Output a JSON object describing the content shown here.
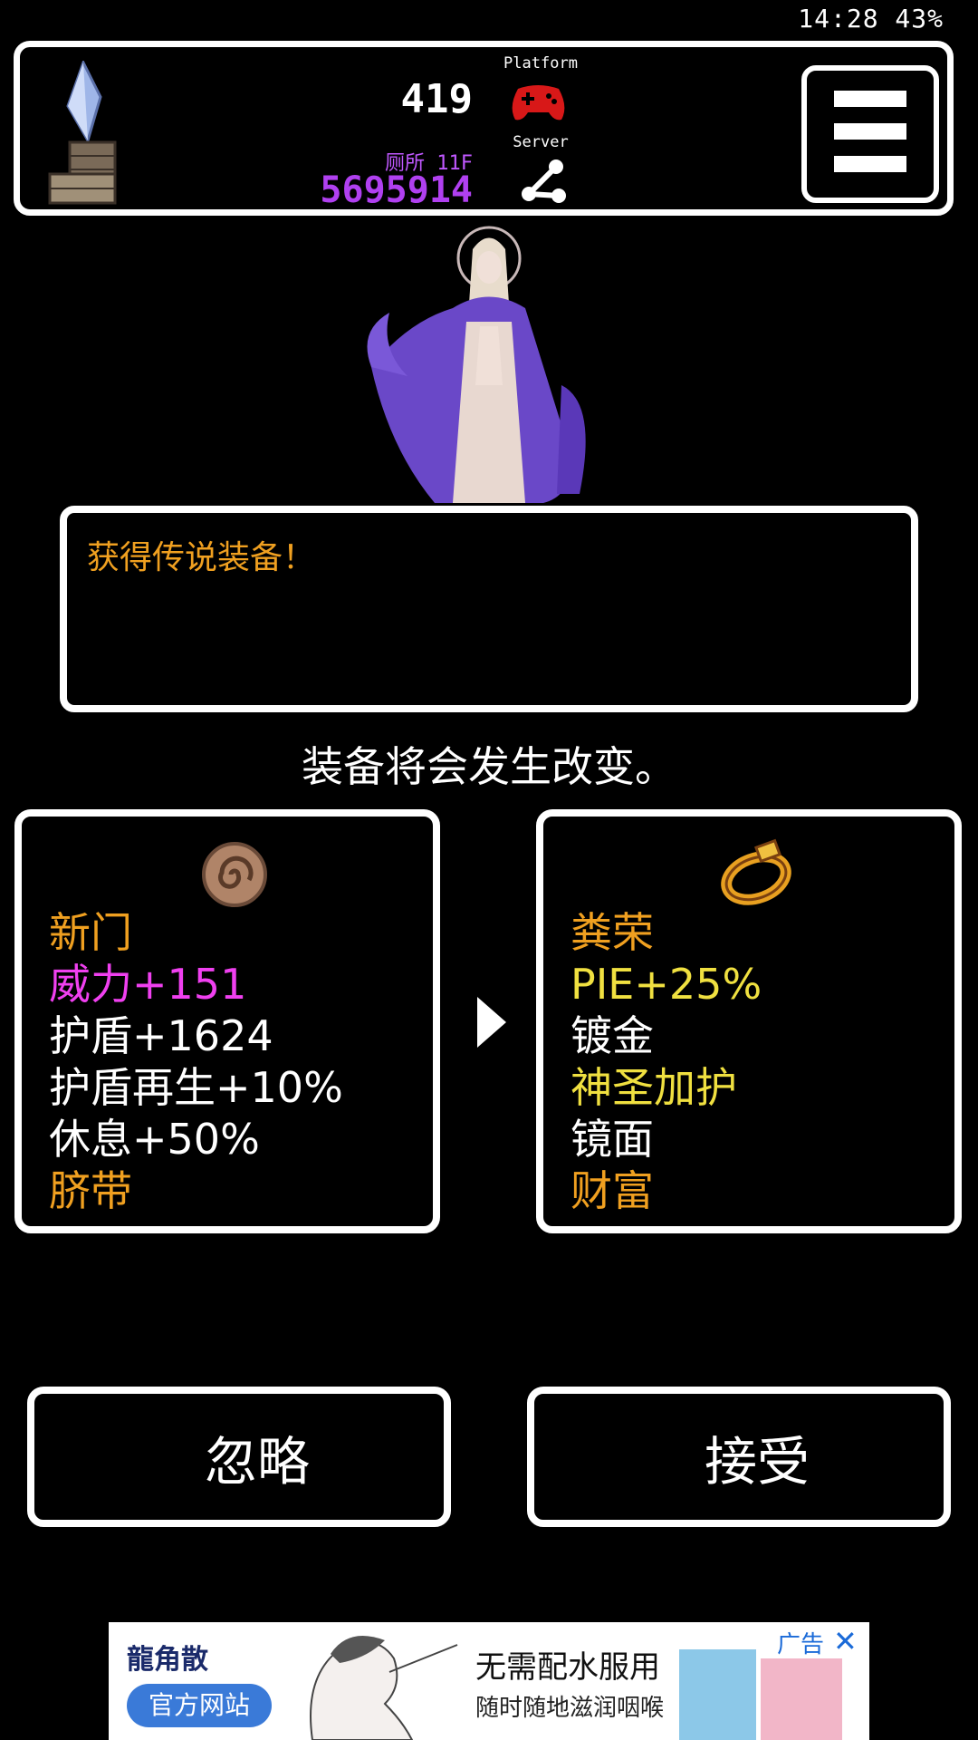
{
  "status_bar": {
    "time": "14:28",
    "battery": "43%"
  },
  "hud": {
    "hp": "419",
    "floor": "厕所 11F",
    "gold": "5695914",
    "platform_label": "Platform",
    "server_label": "Server"
  },
  "message": {
    "text": "获得传说装备！"
  },
  "notice": "装备将会发生改变。",
  "current_item": {
    "icon": "spiral-charm-icon",
    "lines": [
      {
        "text": "新门",
        "color": "#f0a020"
      },
      {
        "text": "威力+151",
        "color": "#f040f0"
      },
      {
        "text": "护盾+1624",
        "color": "#ffffff"
      },
      {
        "text": "护盾再生+10%",
        "color": "#ffffff"
      },
      {
        "text": "休息+50%",
        "color": "#ffffff"
      },
      {
        "text": "脐带",
        "color": "#f0a020"
      }
    ]
  },
  "new_item": {
    "icon": "golden-ring-icon",
    "lines": [
      {
        "text": "粪荣",
        "color": "#f0a020"
      },
      {
        "text": "PIE+25%",
        "color": "#f0e040"
      },
      {
        "text": "镀金",
        "color": "#ffffff"
      },
      {
        "text": "神圣加护",
        "color": "#f0e040"
      },
      {
        "text": "镜面",
        "color": "#ffffff"
      },
      {
        "text": "财富",
        "color": "#f0a020"
      }
    ]
  },
  "buttons": {
    "ignore": "忽略",
    "accept": "接受"
  },
  "ad": {
    "brand": "龍角散",
    "button": "官方网站",
    "headline": "无需配水服用",
    "subline": "随时随地滋润咽喉",
    "tag": "广告",
    "close": "✕"
  },
  "colors": {
    "legendary": "#f0a020",
    "power": "#f040f0",
    "bonus": "#f0e040",
    "gold": "#b040f0"
  }
}
